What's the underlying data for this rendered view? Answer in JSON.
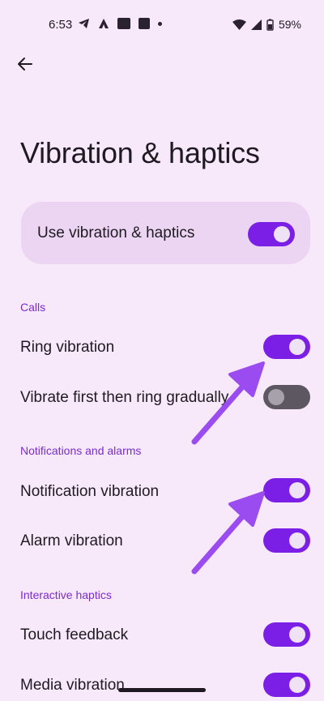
{
  "status_bar": {
    "time": "6:53",
    "battery": "59%"
  },
  "page": {
    "title": "Vibration & haptics"
  },
  "master": {
    "label": "Use vibration & haptics",
    "on": true
  },
  "sections": {
    "calls": "Calls",
    "notifications": "Notifications and alarms",
    "interactive": "Interactive haptics"
  },
  "rows": {
    "ring_vibration": {
      "label": "Ring vibration",
      "on": true
    },
    "vibrate_first": {
      "label": "Vibrate first then ring gradually",
      "on": false
    },
    "notification_vibration": {
      "label": "Notification vibration",
      "on": true
    },
    "alarm_vibration": {
      "label": "Alarm vibration",
      "on": true
    },
    "touch_feedback": {
      "label": "Touch feedback",
      "on": true
    },
    "media_vibration": {
      "label": "Media vibration",
      "on": true
    }
  },
  "colors": {
    "background": "#f8e9fa",
    "accent": "#7b1ee6",
    "section_header": "#7a2ccd",
    "annotation_arrow": "#9a4cf0"
  }
}
